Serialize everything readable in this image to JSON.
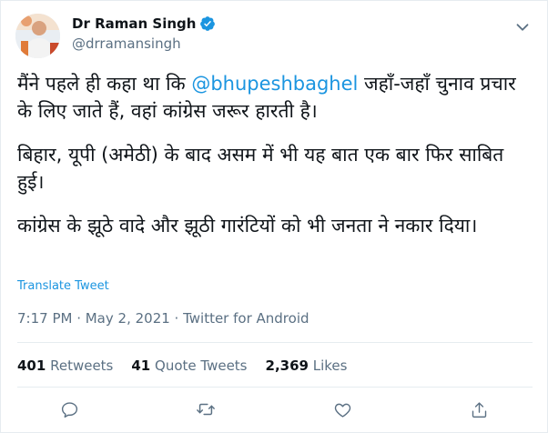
{
  "tweet": {
    "author_name": "Dr Raman Singh",
    "handle": "@drramansingh",
    "para1_a": "मैंने पहले ही कहा था कि ",
    "para1_mention": "@bhupeshbaghel",
    "para1_b": " जहाँ-जहाँ चुनाव प्रचार के लिए जाते हैं, वहां कांग्रेस जरूर हारती है।",
    "para2": "बिहार, यूपी (अमेठी) के बाद असम में भी यह बात एक बार फिर साबित हुई।",
    "para3": "कांग्रेस के झूठे वादे और झूठी गारंटियों को भी जनता ने नकार दिया।",
    "translate_label": "Translate Tweet",
    "timestamp": "7:17 PM · May 2, 2021 · Twitter for Android"
  },
  "stats": {
    "retweets_count": "401",
    "retweets_label": "Retweets",
    "quotes_count": "41",
    "quotes_label": "Quote Tweets",
    "likes_count": "2,369",
    "likes_label": "Likes"
  },
  "icons": {
    "verified": "verified-badge-icon",
    "more": "chevron-down-icon",
    "reply": "reply-icon",
    "retweet": "retweet-icon",
    "like": "heart-icon",
    "share": "share-icon"
  },
  "colors": {
    "accent": "#1b95e0",
    "text": "#0f1419",
    "secondary": "#5b7083",
    "border": "#e6ecf0"
  }
}
